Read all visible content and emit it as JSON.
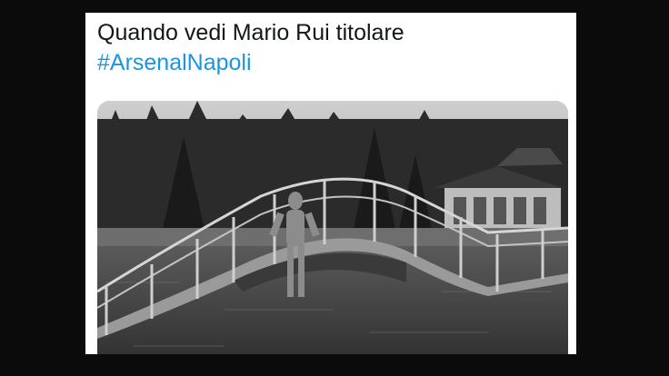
{
  "tweet": {
    "text": "Quando vedi Mario Rui titolare",
    "hashtag": "#ArsenalNapoli",
    "link_color": "#1b95e0"
  },
  "media": {
    "description": "black-and-white photo"
  }
}
